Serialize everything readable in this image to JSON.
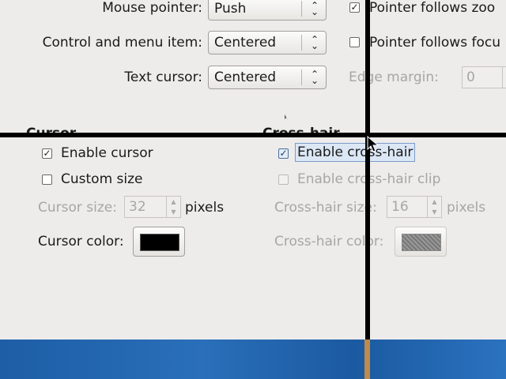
{
  "zoom": {
    "mouse_pointer_label": "Mouse pointer:",
    "mouse_pointer_value": "Push",
    "control_label": "Control and menu item:",
    "control_value": "Centered",
    "text_cursor_label": "Text cursor:",
    "text_cursor_value": "Centered",
    "pointer_follows_zoom": "Pointer follows zoo",
    "pointer_follows_focus": "Pointer follows focu",
    "edge_margin_label": "Edge margin:",
    "edge_margin_value": "0"
  },
  "cursor": {
    "title": "Cursor",
    "enable": "Enable cursor",
    "custom_size": "Custom size",
    "size_label": "Cursor size:",
    "size_value": "32",
    "size_unit": "pixels",
    "color_label": "Cursor color:",
    "color": "#000000"
  },
  "crosshair": {
    "title": "Cross-hair",
    "enable": "Enable cross-hair",
    "clip": "Enable cross-hair clip",
    "size_label": "Cross-hair size:",
    "size_value": "16",
    "size_unit": "pixels",
    "color_label": "Cross-hair color:"
  },
  "checks": {
    "pointer_follows_zoom": "✓",
    "enable_cursor": "✓",
    "enable_crosshair": "✓"
  },
  "spin_arrows": {
    "up": "▲",
    "down": "▼"
  },
  "combo_arrow": "⌃⌄",
  "colors": {
    "crosshair_line": "#000000",
    "panel_background": "#1e5fa8",
    "focus_fill": "#dce7f5"
  }
}
